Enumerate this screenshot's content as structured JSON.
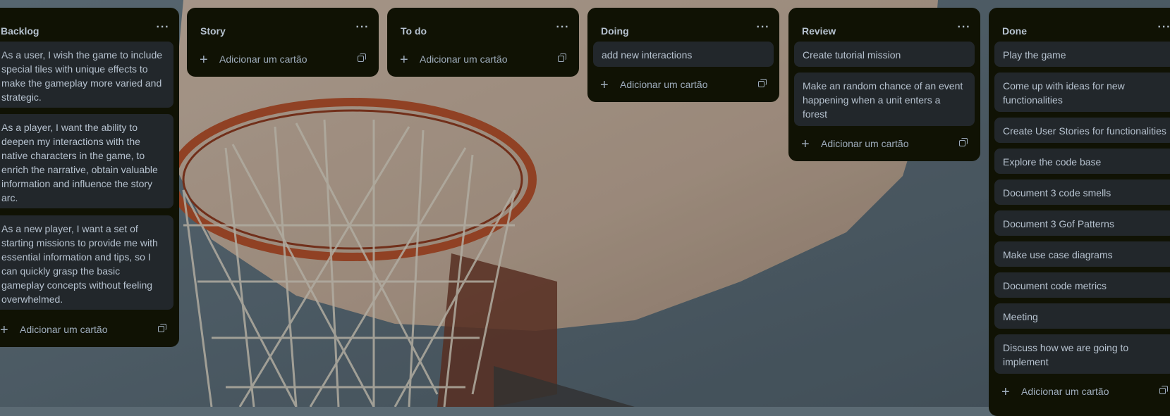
{
  "board": {
    "lists": [
      {
        "title": "Backlog",
        "cards": [
          "As a user, I wish the game to include special tiles with unique effects to make the gameplay more varied and strategic.",
          "As a player, I want the ability to deepen my interactions with the native characters in the game, to enrich the narrative, obtain valuable information and influence the story arc.",
          "As a new player, I want a set of starting missions to provide me with essential information and tips, so I can quickly grasp the basic gameplay concepts without feeling overwhelmed."
        ],
        "add_label": "Adicionar um cartão"
      },
      {
        "title": "Story",
        "cards": [],
        "add_label": "Adicionar um cartão"
      },
      {
        "title": "To do",
        "cards": [],
        "add_label": "Adicionar um cartão"
      },
      {
        "title": "Doing",
        "cards": [
          "add new interactions"
        ],
        "add_label": "Adicionar um cartão"
      },
      {
        "title": "Review",
        "cards": [
          "Create tutorial mission",
          "Make an random chance of an event happening when a unit enters a forest"
        ],
        "add_label": "Adicionar um cartão"
      },
      {
        "title": "Done",
        "cards": [
          "Play the game",
          "Come up with ideas for new functionalities",
          "Create User Stories for functionalities",
          "Explore the code base",
          "Document 3 code smells",
          "Document 3 Gof Patterns",
          "Make use case diagrams",
          "Document code metrics",
          "Meeting",
          "Discuss how we are going to implement"
        ],
        "add_label": "Adicionar um cartão"
      }
    ]
  },
  "icons": {
    "list_menu": "more-horizontal-icon",
    "add": "plus-icon",
    "template": "card-template-icon"
  },
  "colors": {
    "list_bg": "#101204",
    "card_bg": "#22272b",
    "text": "#b6c2cf",
    "subtle_text": "#9fadbc"
  }
}
